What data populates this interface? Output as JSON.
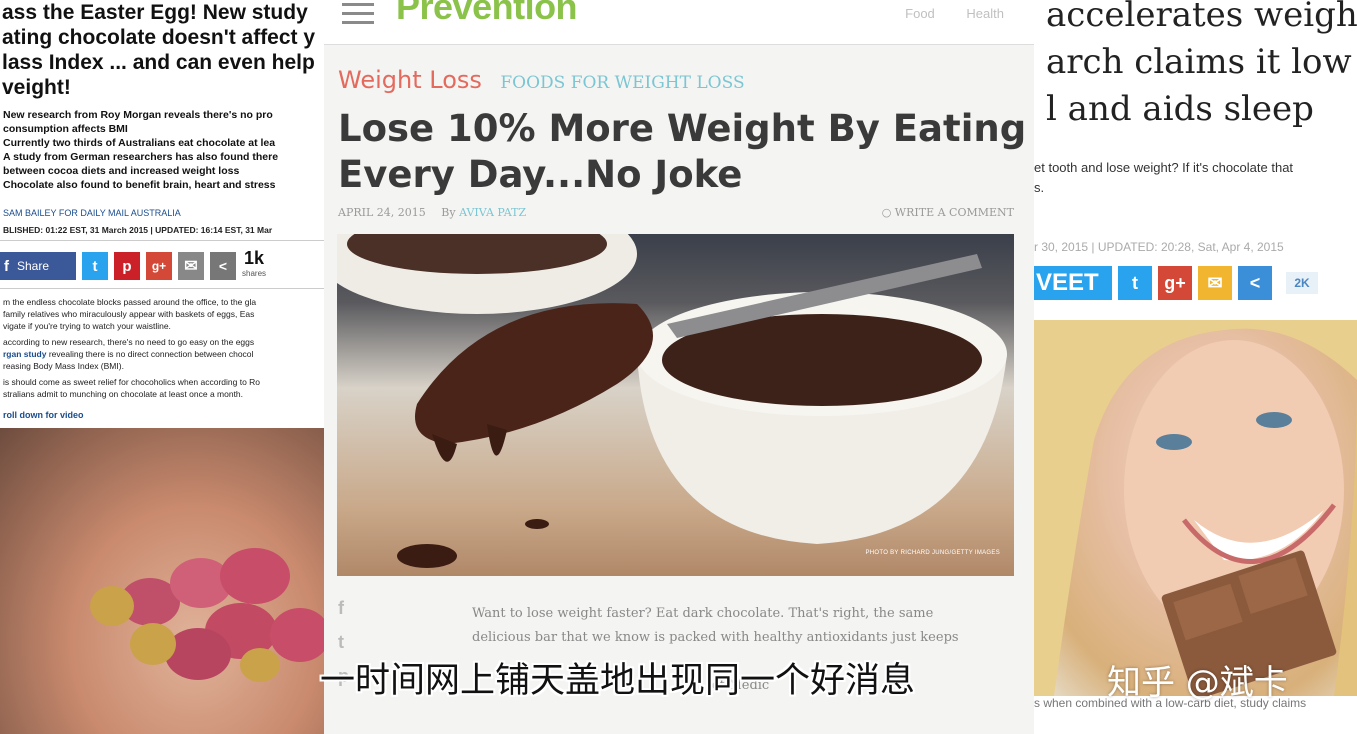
{
  "left": {
    "headline": [
      "ass the Easter Egg! New study",
      "ating chocolate doesn't affect y",
      "lass Index ... and can even help",
      "veight!"
    ],
    "bullets": [
      "New research from Roy Morgan reveals there's no pro",
      "consumption affects BMI",
      "Currently two thirds of Australians eat chocolate at lea",
      "A study from German researchers has also found there",
      "between cocoa diets and increased weight loss",
      "Chocolate also found to benefit brain, heart and stress"
    ],
    "byline": "SAM BAILEY FOR DAILY MAIL AUSTRALIA",
    "published": "BLISHED: 01:22 EST, 31 March 2015 | UPDATED: 16:14 EST, 31 Mar",
    "share_label": "Share",
    "share_count": "1k",
    "share_count_label": "shares",
    "body": [
      [
        "m the endless chocolate blocks passed around the office, to the gla",
        "family relatives who miraculously appear with baskets of eggs, Eas",
        "vigate if you're trying to watch your waistline."
      ],
      [
        "according to new research, there's no need to go easy on the eggs",
        "rgan study",
        " revealing there is no direct connection between chocol",
        "reasing Body Mass Index (BMI)."
      ],
      [
        "is should come as sweet relief for chocoholics when according to Ro",
        "stralians admit to munching on chocolate at least once a month."
      ]
    ],
    "scroll_link": "roll down for video"
  },
  "mid": {
    "brand": "Prevention",
    "nav": [
      "Food",
      "Health"
    ],
    "category": "Weight Loss",
    "subcategory": "FOODS FOR WEIGHT LOSS",
    "title_lines": [
      "Lose 10% More Weight By Eating A",
      "Every Day...No Joke"
    ],
    "date": "APRIL 24, 2015",
    "by": "By",
    "author": "AVIVA PATZ",
    "comment": "WRITE A COMMENT",
    "photo_credit": "PHOTO BY RICHARD JUNG/GETTY IMAGES",
    "social_icons": [
      "f",
      "t",
      "p"
    ],
    "body_lines": [
      "Want to lose weight faster? Eat dark chocolate. That's right, the same",
      "delicious bar that we know is packed with healthy antioxidants just keeps",
      "",
      "                                                          of Medic"
    ]
  },
  "right": {
    "headline": [
      "accelerates weigh",
      "arch claims it low",
      "l and aids sleep"
    ],
    "dek": [
      "et tooth and lose weight? If it's chocolate that",
      "s."
    ],
    "date": "r 30, 2015 | UPDATED: 20:28, Sat, Apr 4, 2015",
    "tweet_label": "VEET",
    "share_count": "2K",
    "caption": "s when combined with a low-carb diet, study claims"
  },
  "overlay": {
    "subtitle": "一时间网上铺天盖地出现同一个好消息",
    "watermark": "知乎 @斌卡"
  },
  "colors": {
    "brand_green": "#8bc34a",
    "category_red": "#e46a5e",
    "subcategory_teal": "#7ac6d4",
    "facebook": "#3b5998",
    "twitter": "#2aa3ef"
  }
}
